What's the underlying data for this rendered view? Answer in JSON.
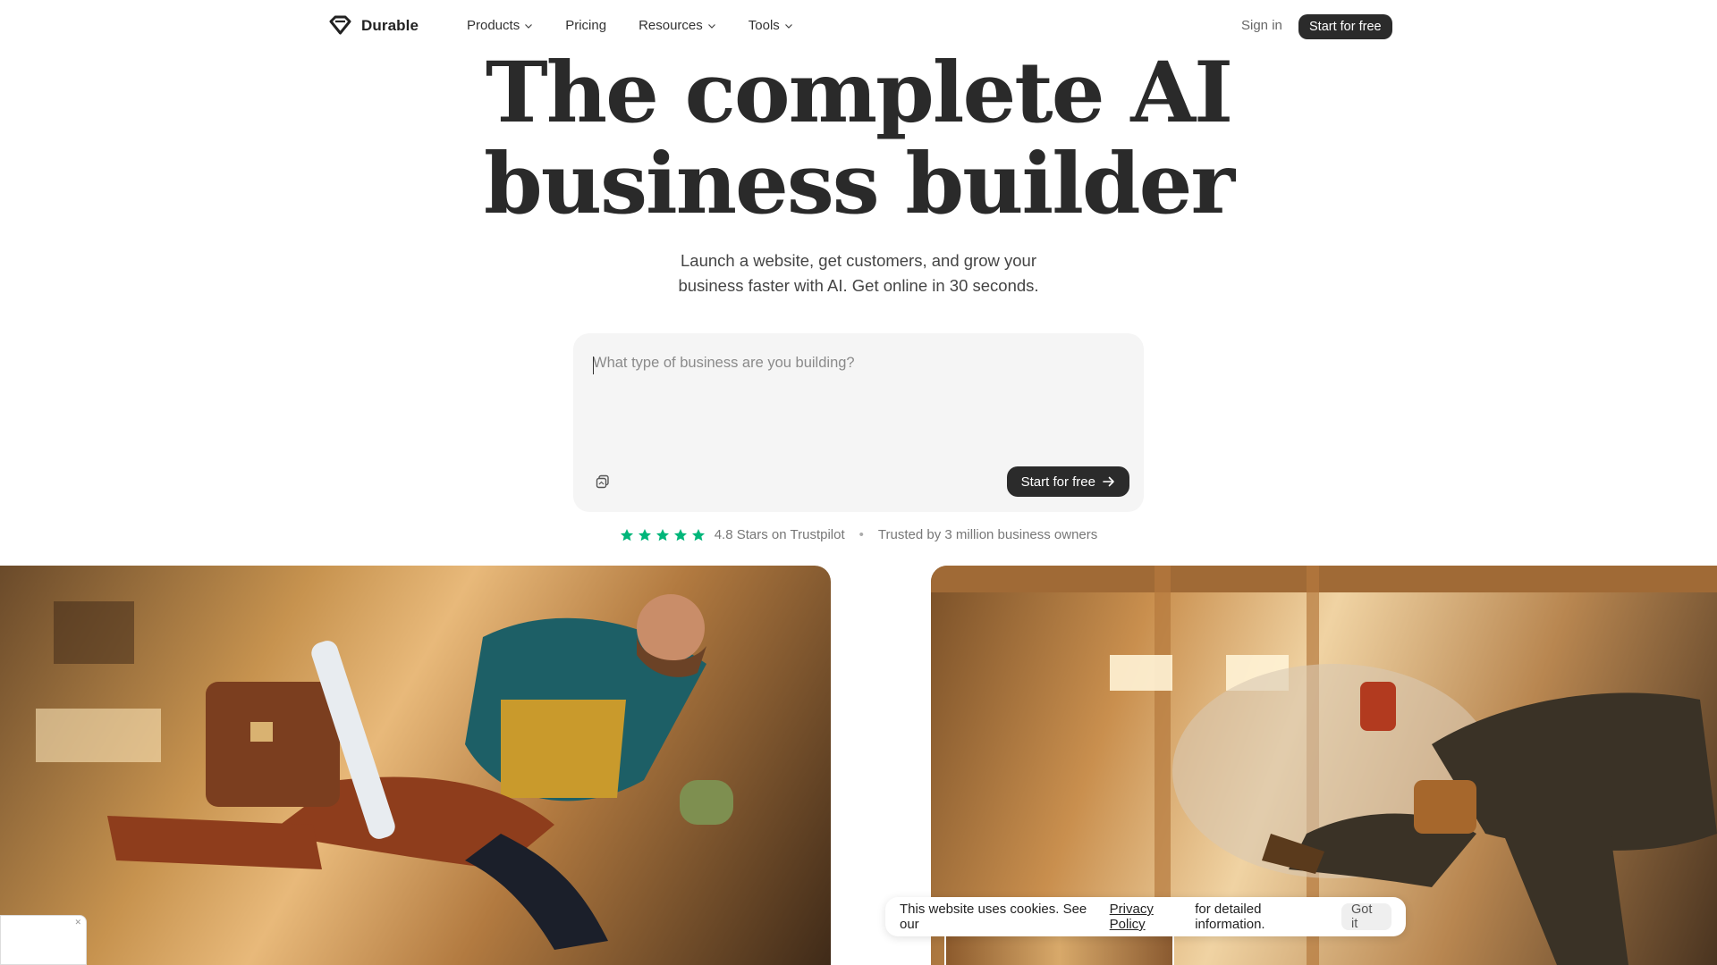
{
  "brand": {
    "name": "Durable"
  },
  "nav": {
    "items": [
      {
        "label": "Products",
        "has_dropdown": true
      },
      {
        "label": "Pricing",
        "has_dropdown": false
      },
      {
        "label": "Resources",
        "has_dropdown": true
      },
      {
        "label": "Tools",
        "has_dropdown": true
      }
    ],
    "sign_in": "Sign in",
    "cta": "Start for free"
  },
  "hero": {
    "headline_line1": "The complete AI",
    "headline_line2": "business builder",
    "subhead_line1": "Launch a website, get customers, and grow your",
    "subhead_line2": "business faster with AI. Get online in 30 seconds."
  },
  "prompt": {
    "placeholder": "What type of business are you building?",
    "value": "",
    "cta": "Start for free",
    "attach_icon": "attach-icon"
  },
  "trust": {
    "rating_stars": 4.8,
    "rating_text": "4.8 Stars on Trustpilot",
    "separator": "•",
    "trusted_text": "Trusted by 3 million business owners",
    "star_color": "#00b67a"
  },
  "cookie": {
    "text_before": "This website uses cookies. See our",
    "link": "Privacy Policy",
    "text_after": "for detailed information.",
    "button": "Got it"
  },
  "colors": {
    "dark_button": "#2b2b2b",
    "prompt_bg": "#f5f5f5"
  }
}
